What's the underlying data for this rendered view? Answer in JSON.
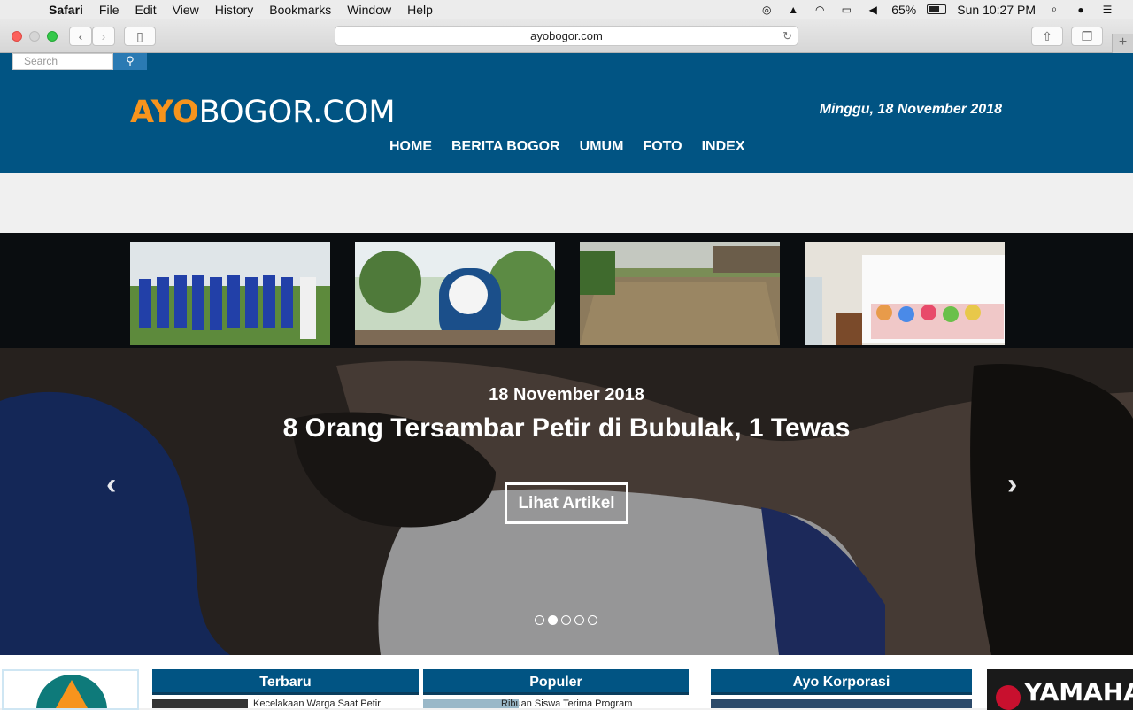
{
  "menubar": {
    "app": "Safari",
    "items": [
      "File",
      "Edit",
      "View",
      "History",
      "Bookmarks",
      "Window",
      "Help"
    ],
    "battery": "65%",
    "clock": "Sun 10:27 PM"
  },
  "browser": {
    "url": "ayobogor.com"
  },
  "site": {
    "search_placeholder": "Search",
    "logo_ayo": "AYO",
    "logo_rest": "BOGOR.COM",
    "date": "Minggu, 18 November 2018",
    "nav": [
      "HOME",
      "BERITA BOGOR",
      "UMUM",
      "FOTO",
      "INDEX"
    ]
  },
  "hero": {
    "date": "18 November 2018",
    "title": "8 Orang Tersambar Petir di Bubulak, 1 Tewas",
    "button": "Lihat Artikel",
    "slide_count": 5,
    "active_slide": 2
  },
  "sections": {
    "terbaru": {
      "title": "Terbaru",
      "first_item": "Kecelakaan Warga Saat Petir"
    },
    "populer": {
      "title": "Populer",
      "first_item": "Ribuan Siswa Terima Program"
    },
    "korporasi": {
      "title": "Ayo Korporasi"
    }
  },
  "ad": {
    "brand": "YAMAHA"
  },
  "colors": {
    "brand_blue": "#015483",
    "brand_orange": "#f7941d"
  }
}
